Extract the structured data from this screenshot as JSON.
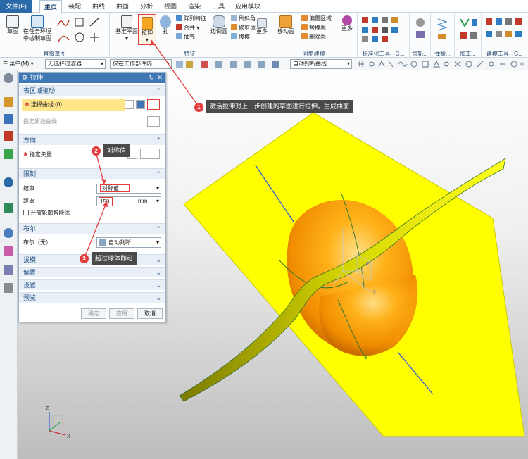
{
  "menu": {
    "tabs": [
      "文件(F)",
      "主页",
      "装配",
      "曲线",
      "曲面",
      "分析",
      "视图",
      "渲染",
      "工具",
      "应用模块"
    ]
  },
  "ribbon": {
    "sketch_group": {
      "label": "直接草图",
      "sketch": "草图",
      "sketch_in_task": "在任务环境中绘制草图"
    },
    "feature_group": {
      "label": "特征",
      "datum_plane": "基准平面",
      "extrude": "拉伸",
      "hole": "孔",
      "pattern_feature": "阵列特征",
      "unite": "合并",
      "shell": "抽壳",
      "edge_blend": "边倒圆",
      "chamfer": "倒斜角",
      "trim_body": "修剪体",
      "draft": "拔模",
      "more": "更多"
    },
    "sync_group": {
      "label": "同步建模",
      "move_face": "移动面",
      "offset_region": "偏置区域",
      "replace_face": "替换面",
      "delete_face": "删除面",
      "more": "更多"
    },
    "other_groups": [
      "标准化工具 - G...",
      "齿轮...",
      "弹簧...",
      "加工...",
      "建模工具 - G..."
    ]
  },
  "toolbar2": {
    "menu": "菜单(M)",
    "filter": "无选择过滤器",
    "scope": "仅在工作部件内",
    "curve_rule": "自动判断曲线"
  },
  "dialog": {
    "title": "拉伸",
    "section_curve": "表区域驱动",
    "select_curve": "选择曲线 (0)",
    "specify_origin": "指定原始曲线",
    "section_direction": "方向",
    "specify_vector": "指定矢量",
    "section_limits": "限制",
    "end_label": "结束",
    "end_value": "对称值",
    "distance_label": "距离",
    "distance_value": "150",
    "distance_unit": "mm",
    "open_profile": "开放轮廓智能体",
    "section_boolean": "布尔",
    "boolean_label": "布尔（无）",
    "boolean_value": "自动判断",
    "section_draft": "拔模",
    "section_offset": "偏置",
    "section_settings": "设置",
    "section_preview": "预览",
    "ok": "确定",
    "apply": "应用",
    "cancel": "取消"
  },
  "callouts": [
    {
      "num": "1",
      "text": "激活拉伸对上一步创建的草图进行拉伸，生成曲面"
    },
    {
      "num": "2",
      "text": "对称值"
    },
    {
      "num": "3",
      "text": "超过球体即可"
    }
  ],
  "colors": {
    "accent": "#3f78b5",
    "callout": "#e23b3b",
    "surface": "#ffff00",
    "sphere": "#ff9c00"
  }
}
